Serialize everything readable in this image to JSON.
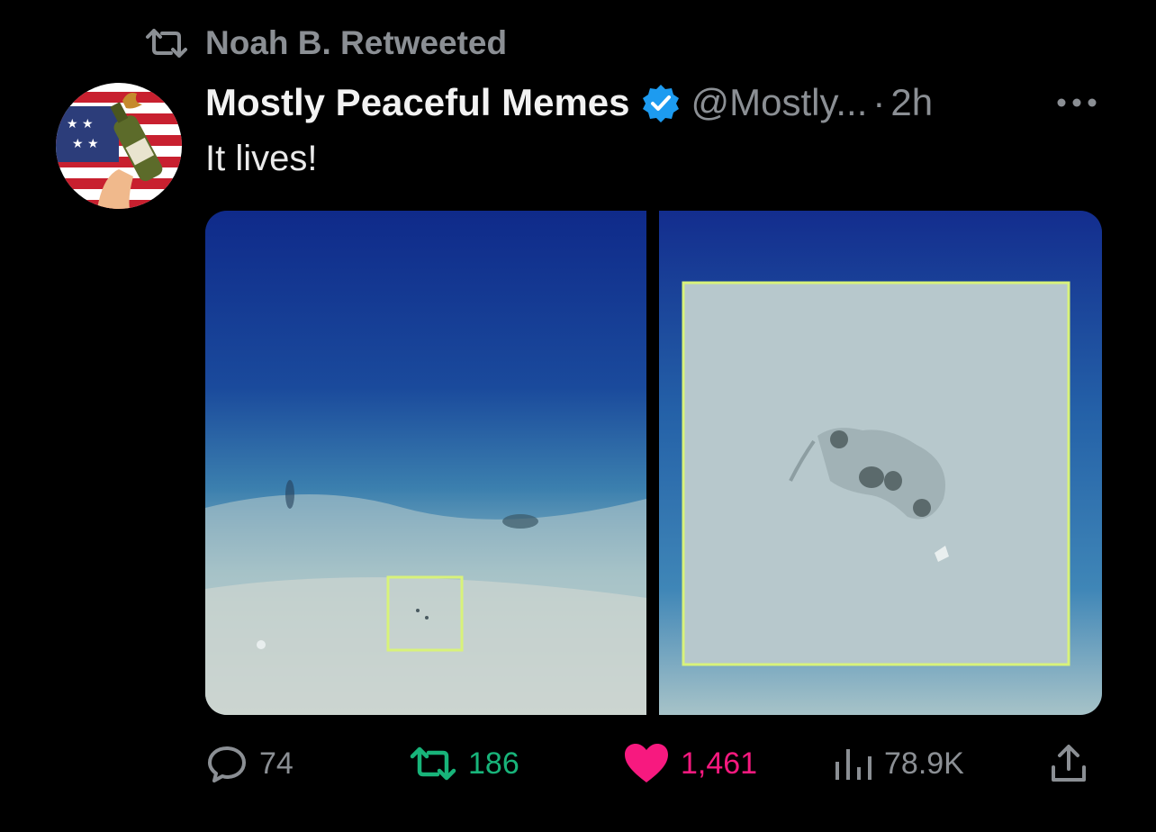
{
  "retweet_banner": {
    "text": "Noah B. Retweeted",
    "icon": "retweet-icon"
  },
  "author": {
    "display_name": "Mostly Peaceful Memes",
    "handle": "@Mostly...",
    "separator": "·",
    "time": "2h",
    "verified": true
  },
  "tweet": {
    "text": "It lives!"
  },
  "media": {
    "description_icon": "ocean-floor-image-pair"
  },
  "actions": {
    "reply_count": "74",
    "retweet_count": "186",
    "like_count": "1,461",
    "views_count": "78.9K"
  },
  "colors": {
    "background": "#000000",
    "muted": "#8b8f94",
    "retweet_green": "#18b47a",
    "like_pink": "#f7197f",
    "verified_blue": "#1d9bf0"
  }
}
